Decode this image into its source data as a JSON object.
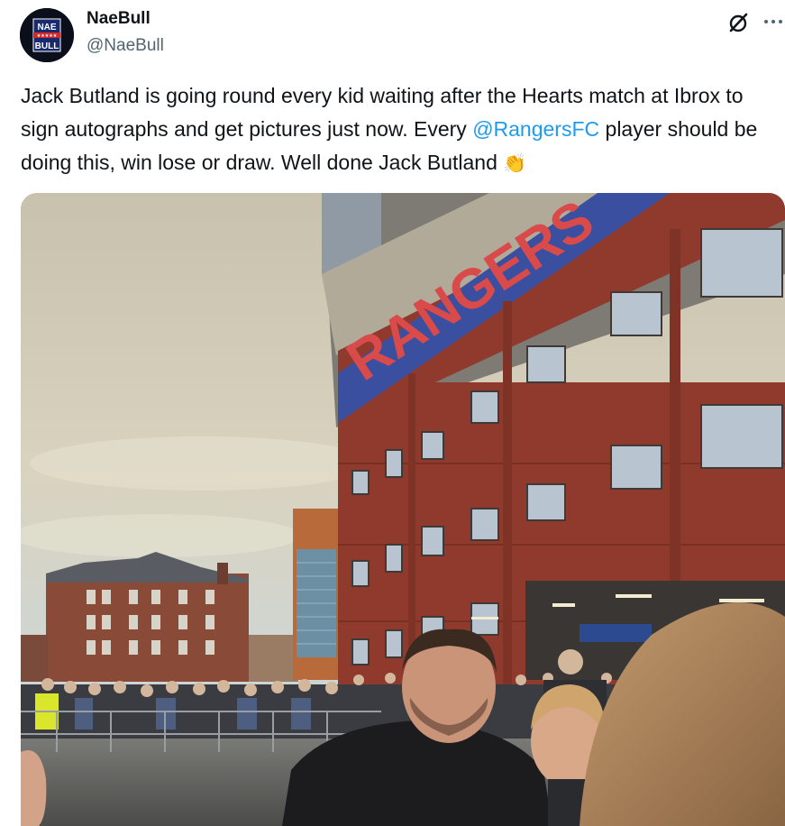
{
  "author": {
    "display_name": "NaeBull",
    "handle": "@NaeBull",
    "avatar_text_top": "NAE",
    "avatar_text_bottom": "BULL",
    "avatar_stars": "★★★★★"
  },
  "tweet": {
    "text_before_mention": "Jack Butland is going round every kid waiting after the Hearts match at Ibrox to sign autographs and get pictures just now. Every ",
    "mention": "@RangersFC",
    "text_after_mention": " player should be doing this, win lose or draw. Well done Jack Butland ",
    "emoji": "👏"
  },
  "photo": {
    "stadium_banner_text": "RANGERS"
  },
  "icons": {
    "grok": "grok-icon",
    "more": "more-icon"
  },
  "colors": {
    "link": "#1d9bf0",
    "secondary_text": "#536471",
    "brick": "#8f3a2c"
  }
}
